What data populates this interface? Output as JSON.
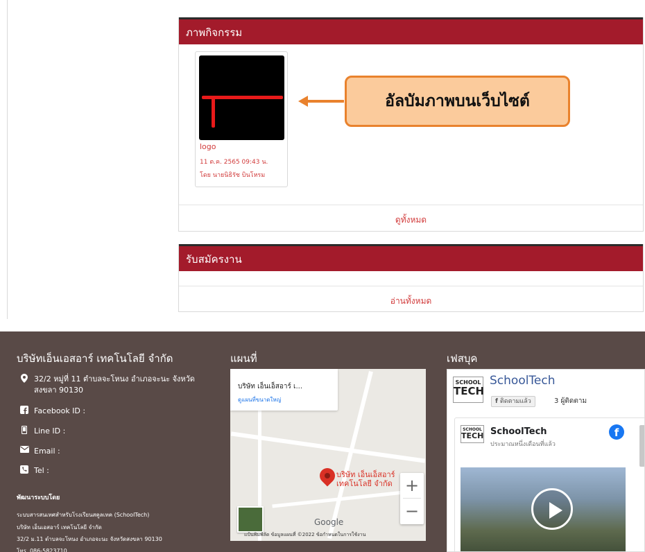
{
  "activity_panel": {
    "title": "ภาพกิจกรรม",
    "album": {
      "title": "logo",
      "date": "11 ต.ค. 2565 09:43 น.",
      "author": "โดย นายนิธิรัช บินโหรม"
    },
    "view_all": "ดูทั้งหมด"
  },
  "callout": {
    "text": "อัลบัมภาพบนเว็บไซต์"
  },
  "jobs_panel": {
    "title": "รับสมัครงาน",
    "read_all": "อ่านทั้งหมด"
  },
  "footer": {
    "company": {
      "heading": "บริษัทเอ็นเอสอาร์ เทคโนโลยี จำกัด",
      "address_line1": "32/2 หมู่ที่ 11 ตำบลจะโหนง อำเภอจะนะ จังหวัด",
      "address_line2": "สงขลา 90130",
      "facebook": "Facebook ID :",
      "line": "Line ID :",
      "email": "Email :",
      "tel": "Tel :",
      "dev_heading": "พัฒนาระบบโดย",
      "dev_line1": "ระบบสารสนเทศสำหรับโรงเรียนสคูลเทค (SchoolTech)",
      "dev_line2": "บริษัท เอ็นเอสอาร์ เทคโนโลยี จำกัด",
      "dev_line3": "32/2 ม.11 ตำบลจะโหนง อำเภอจะนะ จังหวัดสงขลา 90130",
      "dev_line4": "โทร. 086-5823710"
    },
    "map": {
      "heading": "แผนที่",
      "card_title": "บริษัท เอ็นเอ็สอาร์ เ...",
      "card_link": "ดูแผนที่ขนาดใหญ่",
      "marker_line1": "บริษัท เอ็นเอ็สอาร์",
      "marker_line2": "เทคโนโลยี จำกัด",
      "zoom_in": "+",
      "zoom_out": "−",
      "google": "Google",
      "attribution": "แป้นพิมพ์ลัด   ข้อมูลแผนที่ ©2022   ข้อกำหนดในการใช้งาน"
    },
    "facebook": {
      "heading": "เฟสบุค",
      "page_name": "SchoolTech",
      "follow_button": "ติดตามแล้ว",
      "followers": "3 ผู้ติดตาม",
      "post_name": "SchoolTech",
      "post_time": "ประมาณหนึ่งเดือนที่แล้ว",
      "logo_top": "SCHOOL",
      "logo_bottom": "TECH"
    }
  },
  "colors": {
    "panel_header": "#a31b2b",
    "link_red": "#d13a3a",
    "footer_bg": "#594a47",
    "callout_fill": "#fbcb9c",
    "callout_border": "#e9822d",
    "facebook_blue": "#1877f2"
  }
}
